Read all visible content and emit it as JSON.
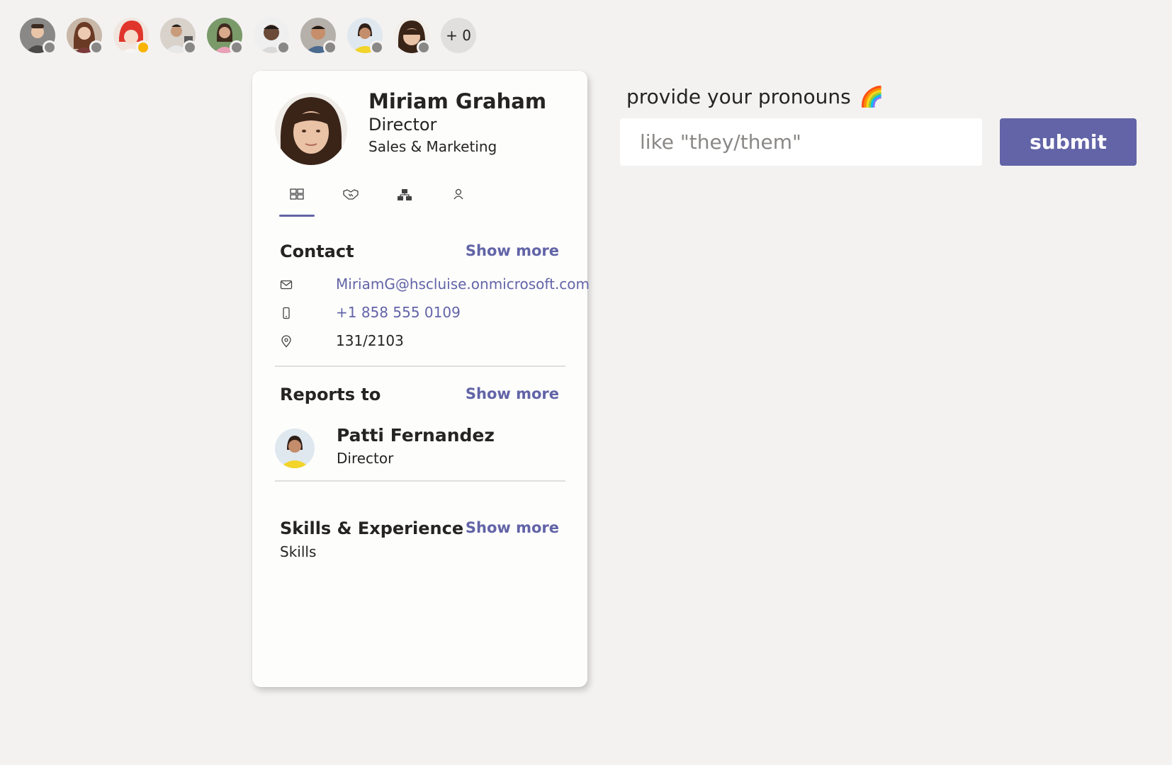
{
  "people_strip": {
    "avatars": [
      {
        "name": "person-1",
        "bg": "#8a8886",
        "presence": "#8a8886"
      },
      {
        "name": "person-2",
        "bg": "#a4262c",
        "presence": "#8a8886"
      },
      {
        "name": "person-3",
        "bg": "#ca5010",
        "presence": "#f8b400"
      },
      {
        "name": "person-4",
        "bg": "#605e5c",
        "presence": "#8a8886"
      },
      {
        "name": "person-5",
        "bg": "#498205",
        "presence": "#8a8886"
      },
      {
        "name": "person-6",
        "bg": "#3b3a39",
        "presence": "#8a8886"
      },
      {
        "name": "person-7",
        "bg": "#5c2e91",
        "presence": "#8a8886"
      },
      {
        "name": "person-8",
        "bg": "#c19c00",
        "presence": "#8a8886"
      },
      {
        "name": "person-9",
        "bg": "#4f2b1e",
        "presence": "#8a8886"
      }
    ],
    "overflow_label": "+ 0"
  },
  "profile": {
    "name": "Miriam Graham",
    "title": "Director",
    "department": "Sales & Marketing",
    "tabs": [
      {
        "icon": "overview-icon",
        "active": true
      },
      {
        "icon": "handshake-icon",
        "active": false
      },
      {
        "icon": "org-chart-icon",
        "active": false
      },
      {
        "icon": "person-icon",
        "active": false
      }
    ],
    "contact": {
      "heading": "Contact",
      "show_more": "Show more",
      "email": "MiriamG@hscluise.onmicrosoft.com",
      "phone": "+1 858 555 0109",
      "location": "131/2103"
    },
    "reports_to": {
      "heading": "Reports to",
      "show_more": "Show more",
      "manager_name": "Patti Fernandez",
      "manager_title": "Director"
    },
    "skills": {
      "heading": "Skills & Experience",
      "show_more": "Show more",
      "subtitle": "Skills"
    }
  },
  "pronouns_form": {
    "prompt": "provide your pronouns",
    "emoji": "🌈",
    "input_value": "",
    "input_placeholder": "like \"they/them\"",
    "submit_label": "submit"
  },
  "colors": {
    "accent": "#6264a7",
    "background": "#f3f2f1",
    "card": "#fdfdfc",
    "presence_offline": "#8a8886",
    "presence_away": "#f8b400"
  }
}
